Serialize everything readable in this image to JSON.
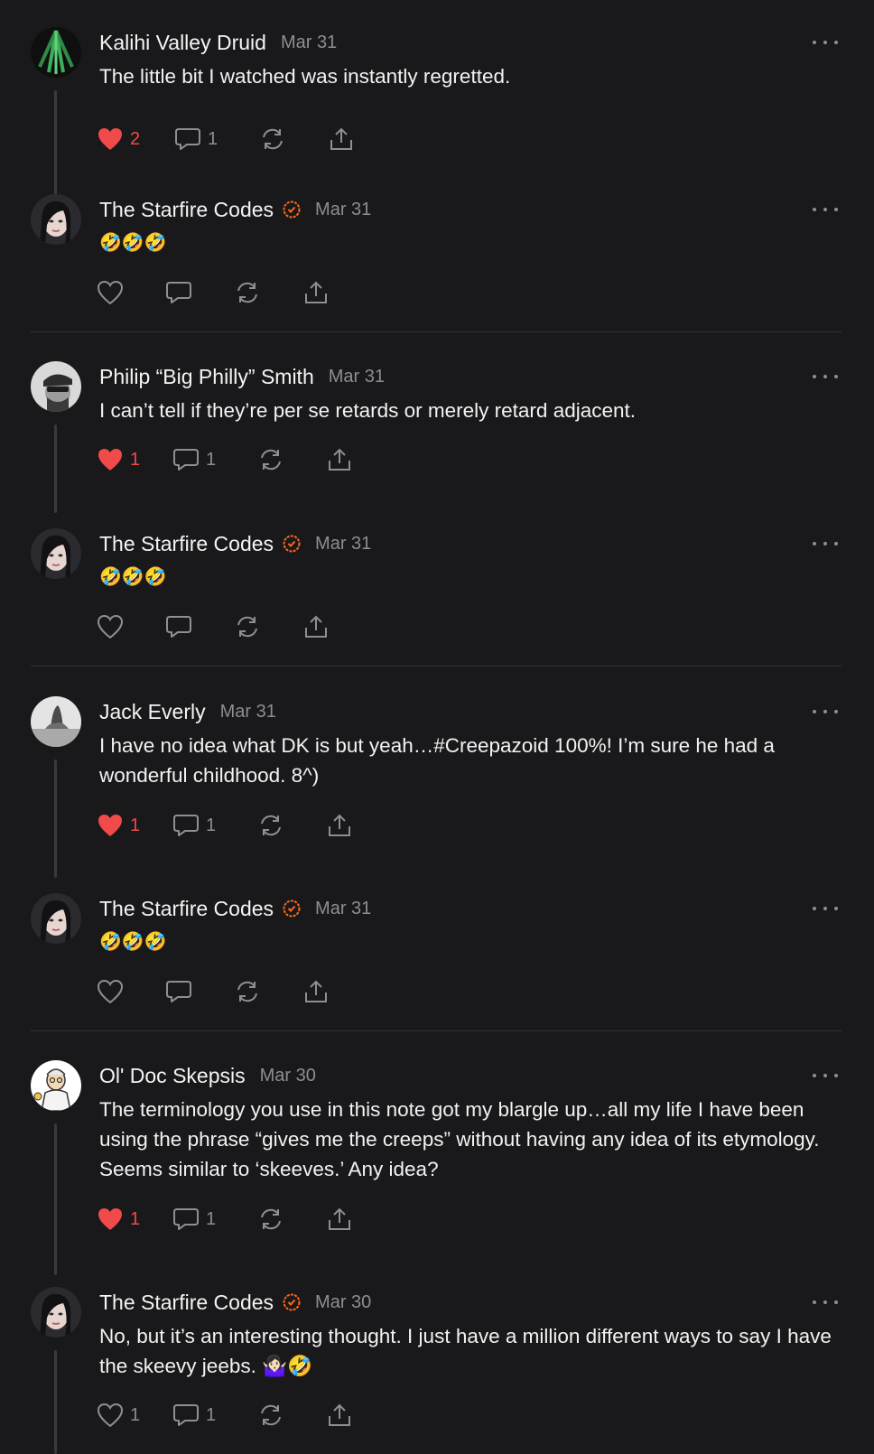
{
  "comments": [
    {
      "author": "Kalihi Valley Druid",
      "date": "Mar 31",
      "verified": false,
      "text": "The little bit I watched was instantly regretted.",
      "likes": "2",
      "liked": true,
      "replies": "1"
    },
    {
      "author": "The Starfire Codes",
      "date": "Mar 31",
      "verified": true,
      "text": "🤣🤣🤣",
      "likes": "",
      "liked": false,
      "replies": ""
    },
    {
      "author": "Philip “Big Philly” Smith",
      "date": "Mar 31",
      "verified": false,
      "text": "I can’t tell if they’re per se retards or merely retard adjacent.",
      "likes": "1",
      "liked": true,
      "replies": "1"
    },
    {
      "author": "The Starfire Codes",
      "date": "Mar 31",
      "verified": true,
      "text": "🤣🤣🤣",
      "likes": "",
      "liked": false,
      "replies": ""
    },
    {
      "author": "Jack Everly",
      "date": "Mar 31",
      "verified": false,
      "text": "I have no idea what DK is but yeah…#Creepazoid 100%! I’m sure he had a wonderful childhood. 8^)",
      "likes": "1",
      "liked": true,
      "replies": "1"
    },
    {
      "author": "The Starfire Codes",
      "date": "Mar 31",
      "verified": true,
      "text": "🤣🤣🤣",
      "likes": "",
      "liked": false,
      "replies": ""
    },
    {
      "author": "Ol' Doc Skepsis",
      "date": "Mar 30",
      "verified": false,
      "text": "The terminology you use in this note got my blargle up…all my life I have been using the phrase “gives me the creeps” without having any idea of its etymology. Seems similar to ‘skeeves.’ Any idea?",
      "likes": "1",
      "liked": true,
      "replies": "1"
    },
    {
      "author": "The Starfire Codes",
      "date": "Mar 30",
      "verified": true,
      "text": "No, but it’s an interesting thought. I just have a million different ways to say I have the skeevy jeebs. 🤷🏻‍♀️🤣",
      "likes": "1",
      "liked": false,
      "replies": "1"
    }
  ],
  "icons": {
    "like": "heart-icon",
    "reply": "speech-bubble-icon",
    "restack": "restack-arrows-icon",
    "share": "share-icon",
    "more": "more-dots-icon",
    "verified": "verified-badge-icon"
  },
  "colors": {
    "background": "#19191b",
    "liked": "#f04a4a",
    "verified": "#ff6719",
    "muted": "#8d8d92"
  }
}
